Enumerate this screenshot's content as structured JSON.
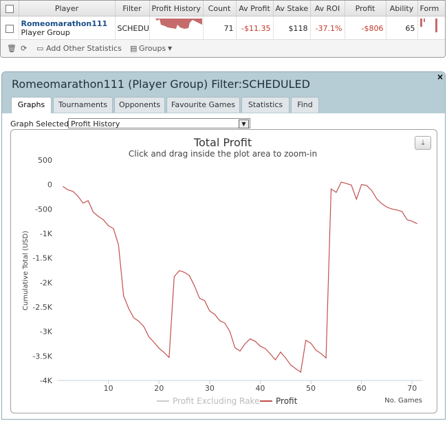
{
  "table": {
    "headers": [
      "Player",
      "Filter",
      "Profit History",
      "Count",
      "Av Profit",
      "Av Stake",
      "Av ROI",
      "Profit",
      "Ability",
      "Form"
    ],
    "row": {
      "player_name": "Romeomarathon111",
      "player_group": "Player Group",
      "filter": "SCHEDULED",
      "count": "71",
      "av_profit": "-$11.35",
      "av_stake": "$118",
      "av_roi": "-37.1%",
      "profit": "-$806",
      "ability": "65"
    }
  },
  "toolbar": {
    "add_stats": "Add Other Statistics",
    "groups": "Groups"
  },
  "panel": {
    "title": "Romeomarathon111 (Player Group) Filter:SCHEDULED",
    "close": "×",
    "tabs": [
      "Graphs",
      "Tournaments",
      "Opponents",
      "Favourite Games",
      "Statistics",
      "Find"
    ],
    "graph_selected_label": "Graph Selected:",
    "graph_selected_value": "Profit History"
  },
  "colors": {
    "profit_line": "#c0504d",
    "excl_rake_line": "#cccccc"
  },
  "chart_data": {
    "type": "line",
    "title": "Total Profit",
    "subtitle": "Click and drag inside the plot area to zoom-in",
    "xlabel": "No. Games",
    "ylabel": "Cumulative Total (USD)",
    "ylim": [
      -4000,
      500
    ],
    "xlim": [
      0,
      72
    ],
    "xticks": [
      "10",
      "20",
      "30",
      "40",
      "50",
      "60",
      "70"
    ],
    "xtick_values": [
      10,
      20,
      30,
      40,
      50,
      60,
      70
    ],
    "yticks": [
      "500",
      "0",
      "-500",
      "-1K",
      "-1.5K",
      "-2K",
      "-2.5K",
      "-3K",
      "-3.5K",
      "-4K"
    ],
    "ytick_values": [
      500,
      0,
      -500,
      -1000,
      -1500,
      -2000,
      -2500,
      -3000,
      -3500,
      -4000
    ],
    "legend": [
      "Profit Excluding Rake",
      "Profit"
    ],
    "series": [
      {
        "name": "Profit",
        "x": [
          1,
          2,
          3,
          4,
          5,
          6,
          7,
          8,
          9,
          10,
          11,
          12,
          13,
          14,
          15,
          16,
          17,
          18,
          19,
          20,
          21,
          22,
          23,
          24,
          25,
          26,
          27,
          28,
          29,
          30,
          31,
          32,
          33,
          34,
          35,
          36,
          37,
          38,
          39,
          40,
          41,
          42,
          43,
          44,
          45,
          46,
          47,
          48,
          49,
          50,
          51,
          52,
          53,
          54,
          55,
          56,
          57,
          58,
          59,
          60,
          61,
          62,
          63,
          64,
          65,
          66,
          67,
          68,
          69,
          70,
          71
        ],
        "values": [
          -40,
          -110,
          -140,
          -240,
          -380,
          -330,
          -560,
          -650,
          -720,
          -840,
          -900,
          -1230,
          -2270,
          -2530,
          -2720,
          -2790,
          -2900,
          -3110,
          -3220,
          -3340,
          -3430,
          -3530,
          -1880,
          -1760,
          -1790,
          -1860,
          -2070,
          -2320,
          -2370,
          -2580,
          -2650,
          -2780,
          -2830,
          -3000,
          -3330,
          -3400,
          -3250,
          -3150,
          -3200,
          -3300,
          -3350,
          -3460,
          -3580,
          -3420,
          -3540,
          -3680,
          -3760,
          -3830,
          -3180,
          -3240,
          -3380,
          -3450,
          -3540,
          -90,
          -160,
          50,
          20,
          -10,
          -300,
          0,
          -20,
          -120,
          -290,
          -390,
          -460,
          -500,
          -520,
          -550,
          -720,
          -750,
          -800
        ]
      },
      {
        "name": "Profit Excluding Rake",
        "x": [],
        "values": []
      }
    ]
  }
}
